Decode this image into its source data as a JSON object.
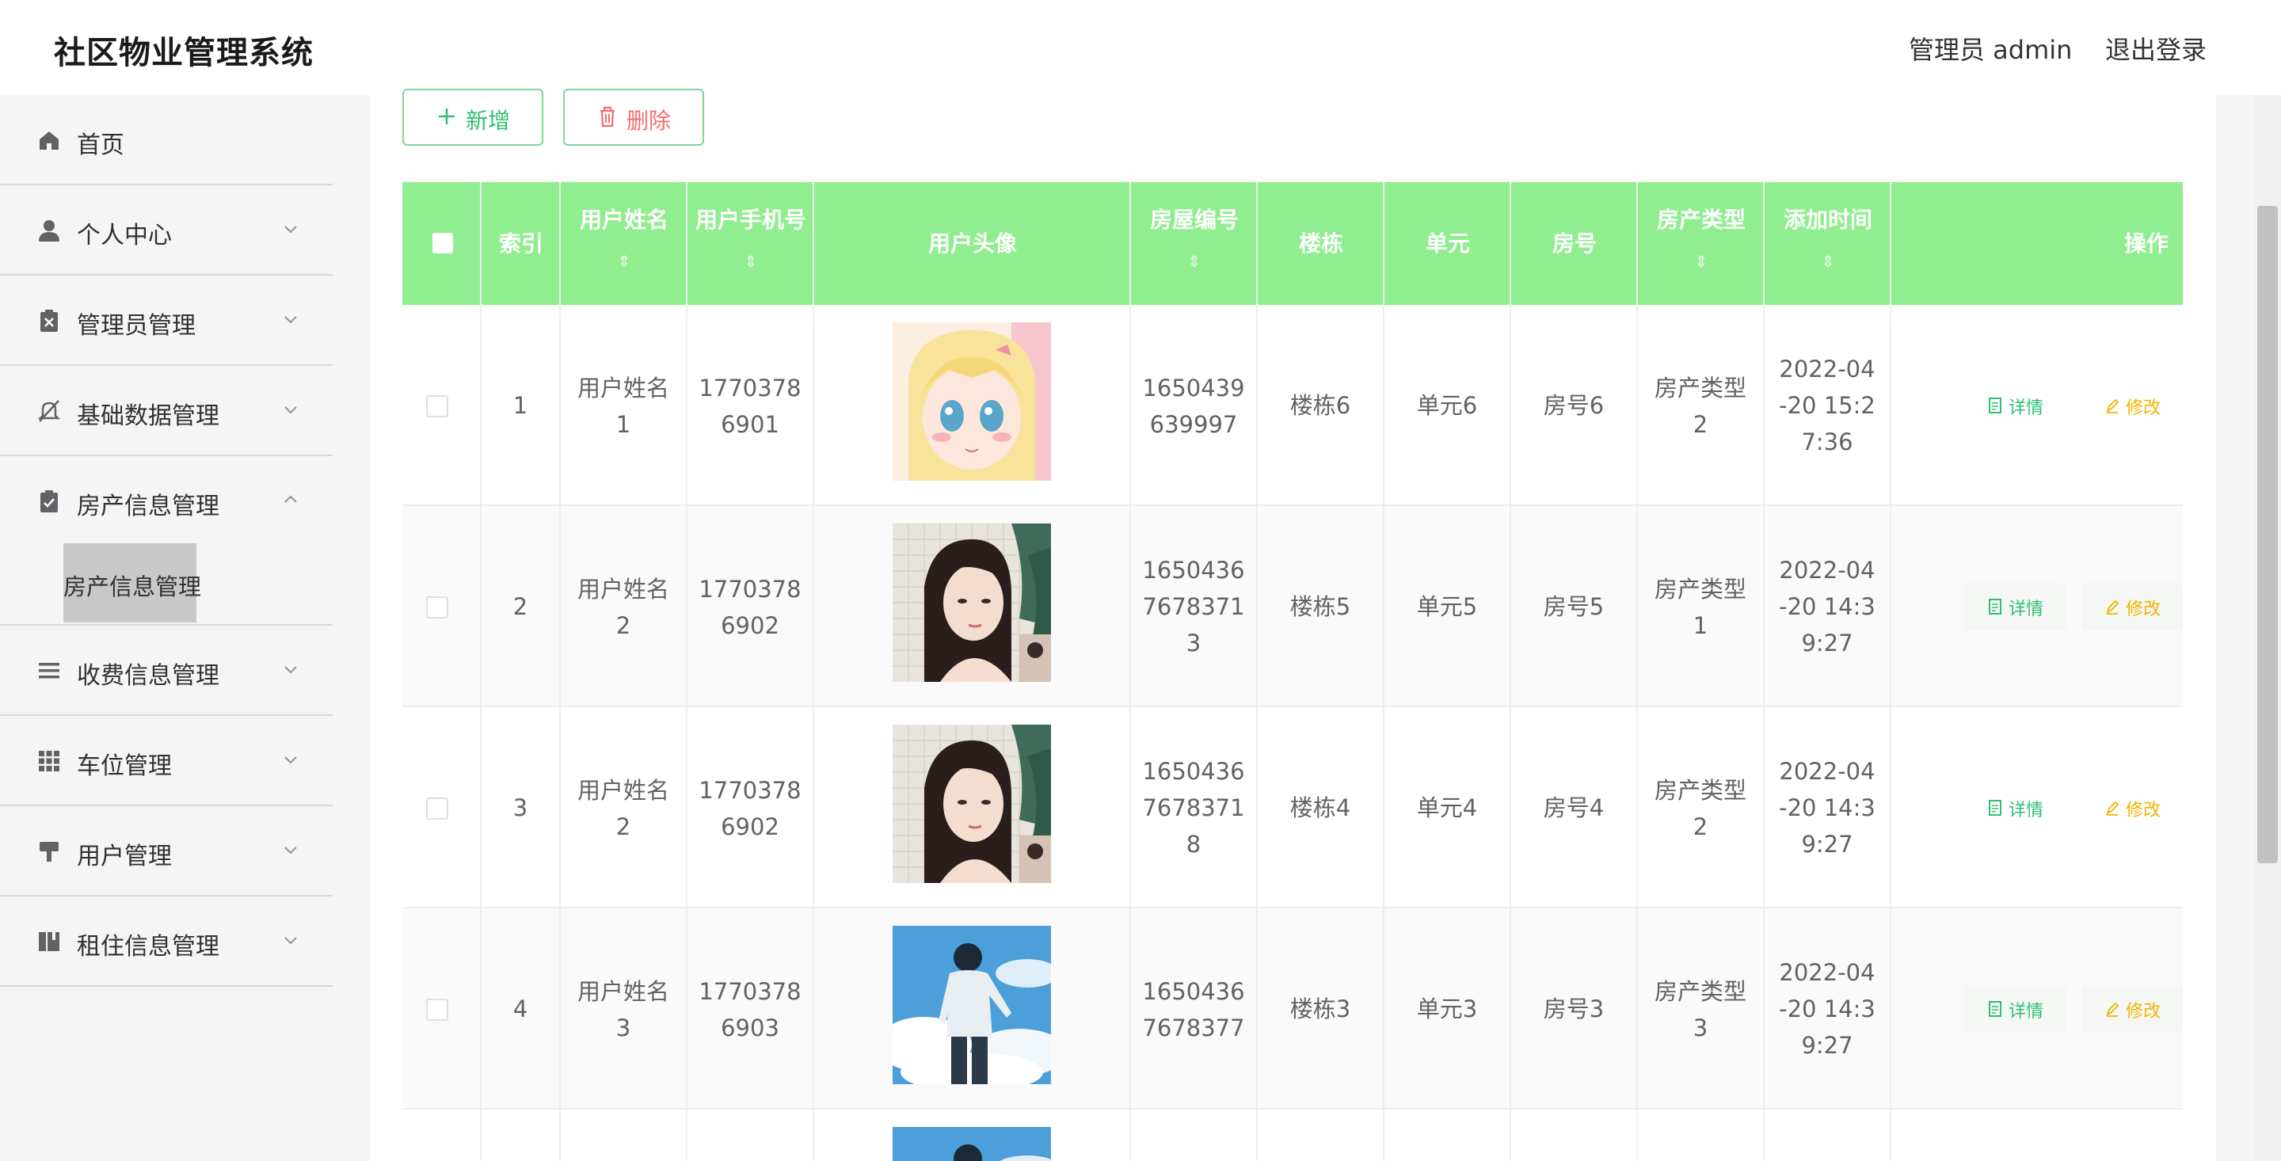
{
  "app": {
    "title": "社区物业管理系统"
  },
  "header": {
    "user_label": "管理员 admin",
    "logout_label": "退出登录"
  },
  "sidebar": {
    "items": [
      {
        "label": "首页",
        "icon": "home-icon"
      },
      {
        "label": "个人中心",
        "icon": "user-icon"
      },
      {
        "label": "管理员管理",
        "icon": "clipboard-x-icon"
      },
      {
        "label": "基础数据管理",
        "icon": "bell-off-icon"
      },
      {
        "label": "房产信息管理",
        "icon": "clipboard-check-icon",
        "expanded": true
      },
      {
        "label": "收费信息管理",
        "icon": "list-icon"
      },
      {
        "label": "车位管理",
        "icon": "grid-icon"
      },
      {
        "label": "用户管理",
        "icon": "stamp-icon"
      },
      {
        "label": "租住信息管理",
        "icon": "book-icon"
      }
    ],
    "active_sub": "房产信息管理"
  },
  "toolbar": {
    "add_label": "新增",
    "delete_label": "删除"
  },
  "table": {
    "header_color": "#90ee90",
    "columns": {
      "index": "索引",
      "name": "用户姓名",
      "phone": "用户手机号",
      "avatar": "用户头像",
      "house_no": "房屋编号",
      "building": "楼栋",
      "unit": "单元",
      "room": "房号",
      "type": "房产类型",
      "time": "添加时间",
      "ops": "操作"
    },
    "rows": [
      {
        "index": "1",
        "name": "用户姓名1",
        "phone": "17703786901",
        "house_no": "1650439639997",
        "building": "楼栋6",
        "unit": "单元6",
        "room": "房号6",
        "type": "房产类型2",
        "time": "2022-04-20 15:27:36",
        "avatar": "anime-girl-avatar"
      },
      {
        "index": "2",
        "name": "用户姓名2",
        "phone": "17703786902",
        "house_no": "16504367678371 3",
        "building": "楼栋5",
        "unit": "单元5",
        "room": "房号5",
        "type": "房产类型1",
        "time": "2022-04-20 14:39:27",
        "avatar": "woman-portrait-avatar"
      },
      {
        "index": "3",
        "name": "用户姓名2",
        "phone": "17703786902",
        "house_no": "16504367678371 8",
        "building": "楼栋4",
        "unit": "单元4",
        "room": "房号4",
        "type": "房产类型2",
        "time": "2022-04-20 14:39:27",
        "avatar": "woman-portrait-avatar"
      },
      {
        "index": "4",
        "name": "用户姓名3",
        "phone": "17703786903",
        "house_no": "16504367678377",
        "building": "楼栋3",
        "unit": "单元3",
        "room": "房号3",
        "type": "房产类型3",
        "time": "2022-04-20 14:39:27",
        "avatar": "boy-sky-avatar"
      }
    ],
    "ops": {
      "detail_label": "详情",
      "edit_label": "修改"
    }
  },
  "lines": {
    "r1": {
      "name": [
        "用户姓名",
        "1"
      ],
      "phone": [
        "1770378",
        "6901"
      ],
      "house": [
        "1650439",
        "639997"
      ],
      "type": [
        "房产类型",
        "2"
      ],
      "time": [
        "2022-04",
        "-20 15:2",
        "7:36"
      ]
    },
    "r2": {
      "name": [
        "用户姓名",
        "2"
      ],
      "phone": [
        "1770378",
        "6902"
      ],
      "house": [
        "1650436",
        "7678371",
        "3"
      ],
      "type": [
        "房产类型",
        "1"
      ],
      "time": [
        "2022-04",
        "-20 14:3",
        "9:27"
      ]
    },
    "r3": {
      "name": [
        "用户姓名",
        "2"
      ],
      "phone": [
        "1770378",
        "6902"
      ],
      "house": [
        "1650436",
        "7678371",
        "8"
      ],
      "type": [
        "房产类型",
        "2"
      ],
      "time": [
        "2022-04",
        "-20 14:3",
        "9:27"
      ]
    },
    "r4": {
      "name": [
        "用户姓名",
        "3"
      ],
      "phone": [
        "1770378",
        "6903"
      ],
      "house": [
        "1650436",
        "7678377"
      ],
      "type": [
        "房产类型",
        "3"
      ],
      "time": [
        "2022-04",
        "-20 14:3",
        "9:27"
      ]
    }
  }
}
